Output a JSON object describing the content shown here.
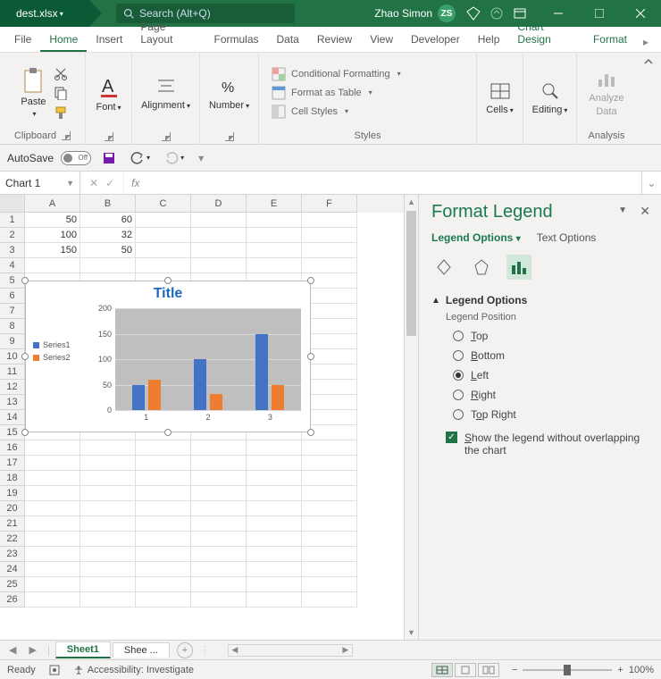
{
  "titlebar": {
    "filename": "dest.xlsx",
    "search_placeholder": "Search (Alt+Q)",
    "user_name": "Zhao Simon",
    "user_initials": "ZS"
  },
  "ribbon_tabs": {
    "file": "File",
    "home": "Home",
    "insert": "Insert",
    "page_layout": "Page Layout",
    "formulas": "Formulas",
    "data": "Data",
    "review": "Review",
    "view": "View",
    "developer": "Developer",
    "help": "Help",
    "chart_design": "Chart Design",
    "format": "Format"
  },
  "ribbon": {
    "clipboard": {
      "paste": "Paste",
      "label": "Clipboard"
    },
    "font": {
      "btn": "Font",
      "label": "Font"
    },
    "alignment": {
      "btn": "Alignment",
      "label": "Alignment"
    },
    "number": {
      "btn": "Number",
      "label": "Number"
    },
    "styles": {
      "cond": "Conditional Formatting",
      "table": "Format as Table",
      "cell": "Cell Styles",
      "label": "Styles"
    },
    "cells": {
      "btn": "Cells",
      "label": "Cells"
    },
    "editing": {
      "btn": "Editing",
      "label": "Editing"
    },
    "analysis": {
      "btn": "Analyze\nData",
      "btn1": "Analyze",
      "btn2": "Data",
      "label": "Analysis"
    }
  },
  "qat": {
    "autosave": "AutoSave",
    "off": "Off"
  },
  "formula_bar": {
    "name": "Chart 1",
    "fx": "fx",
    "value": ""
  },
  "grid": {
    "cols": [
      "A",
      "B",
      "C",
      "D",
      "E",
      "F"
    ],
    "rows": 26,
    "data": {
      "A1": "50",
      "B1": "60",
      "A2": "100",
      "B2": "32",
      "A3": "150",
      "B3": "50"
    }
  },
  "chart_data": {
    "type": "bar",
    "title": "Title",
    "categories": [
      "1",
      "2",
      "3"
    ],
    "series": [
      {
        "name": "Series1",
        "color": "#4472c4",
        "values": [
          50,
          100,
          150
        ]
      },
      {
        "name": "Series2",
        "color": "#ed7d31",
        "values": [
          60,
          32,
          50
        ]
      }
    ],
    "ylim": [
      0,
      200
    ],
    "yticks": [
      0,
      50,
      100,
      150,
      200
    ],
    "legend_position": "left"
  },
  "pane": {
    "title": "Format Legend",
    "tab_legend": "Legend Options",
    "tab_text": "Text Options",
    "section": "Legend Options",
    "sub": "Legend Position",
    "pos_top": "Top",
    "pos_bottom": "Bottom",
    "pos_left": "Left",
    "pos_right": "Right",
    "pos_topright": "Top Right",
    "selected_position": "Left",
    "overlap": "Show the legend without overlapping the chart",
    "overlap_checked": true
  },
  "sheets": {
    "s1": "Sheet1",
    "s2": "Shee",
    "more": "..."
  },
  "status": {
    "ready": "Ready",
    "acc": "Accessibility: Investigate",
    "zoom": "100%"
  }
}
